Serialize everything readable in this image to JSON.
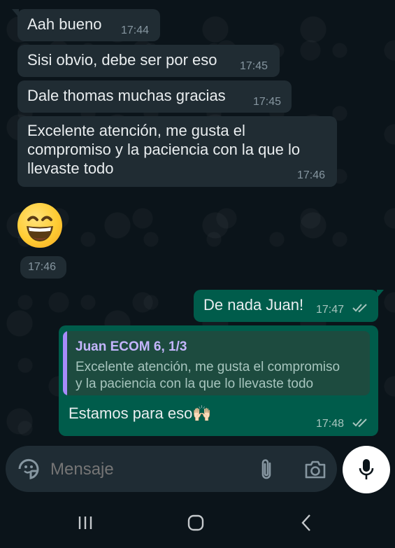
{
  "chat": {
    "messages": [
      {
        "text": "Aah bueno",
        "time": "17:44"
      },
      {
        "text": "Sisi obvio, debe ser por eso",
        "time": "17:45"
      },
      {
        "text": "Dale thomas muchas gracias",
        "time": "17:45"
      },
      {
        "text_lines": [
          "Excelente atención, me gusta el",
          "compromiso y la paciencia con la que lo",
          "llevaste todo"
        ],
        "time": "17:46"
      },
      {
        "emoji": "grinning-face-with-smiling-eyes",
        "time": "17:46"
      }
    ],
    "outgoing": [
      {
        "text": "De nada Juan!",
        "time": "17:47",
        "status": "read"
      },
      {
        "quote_author": "Juan ECOM 6, 1/3",
        "quote_lines": [
          "Excelente atención, me gusta el compromiso",
          "y la paciencia con la que lo llevaste todo"
        ],
        "text": "Estamos para eso🙌🏻",
        "time": "17:48",
        "status": "read"
      }
    ]
  },
  "input": {
    "placeholder": "Mensaje",
    "icons": [
      "sticker-icon",
      "attach-icon",
      "camera-icon",
      "mic-icon"
    ]
  },
  "colors": {
    "background": "#0b141a",
    "incoming": "#202c33",
    "outgoing": "#005c4b",
    "quote_accent": "#a78bfa",
    "read_ticks": "#a7c5be"
  }
}
